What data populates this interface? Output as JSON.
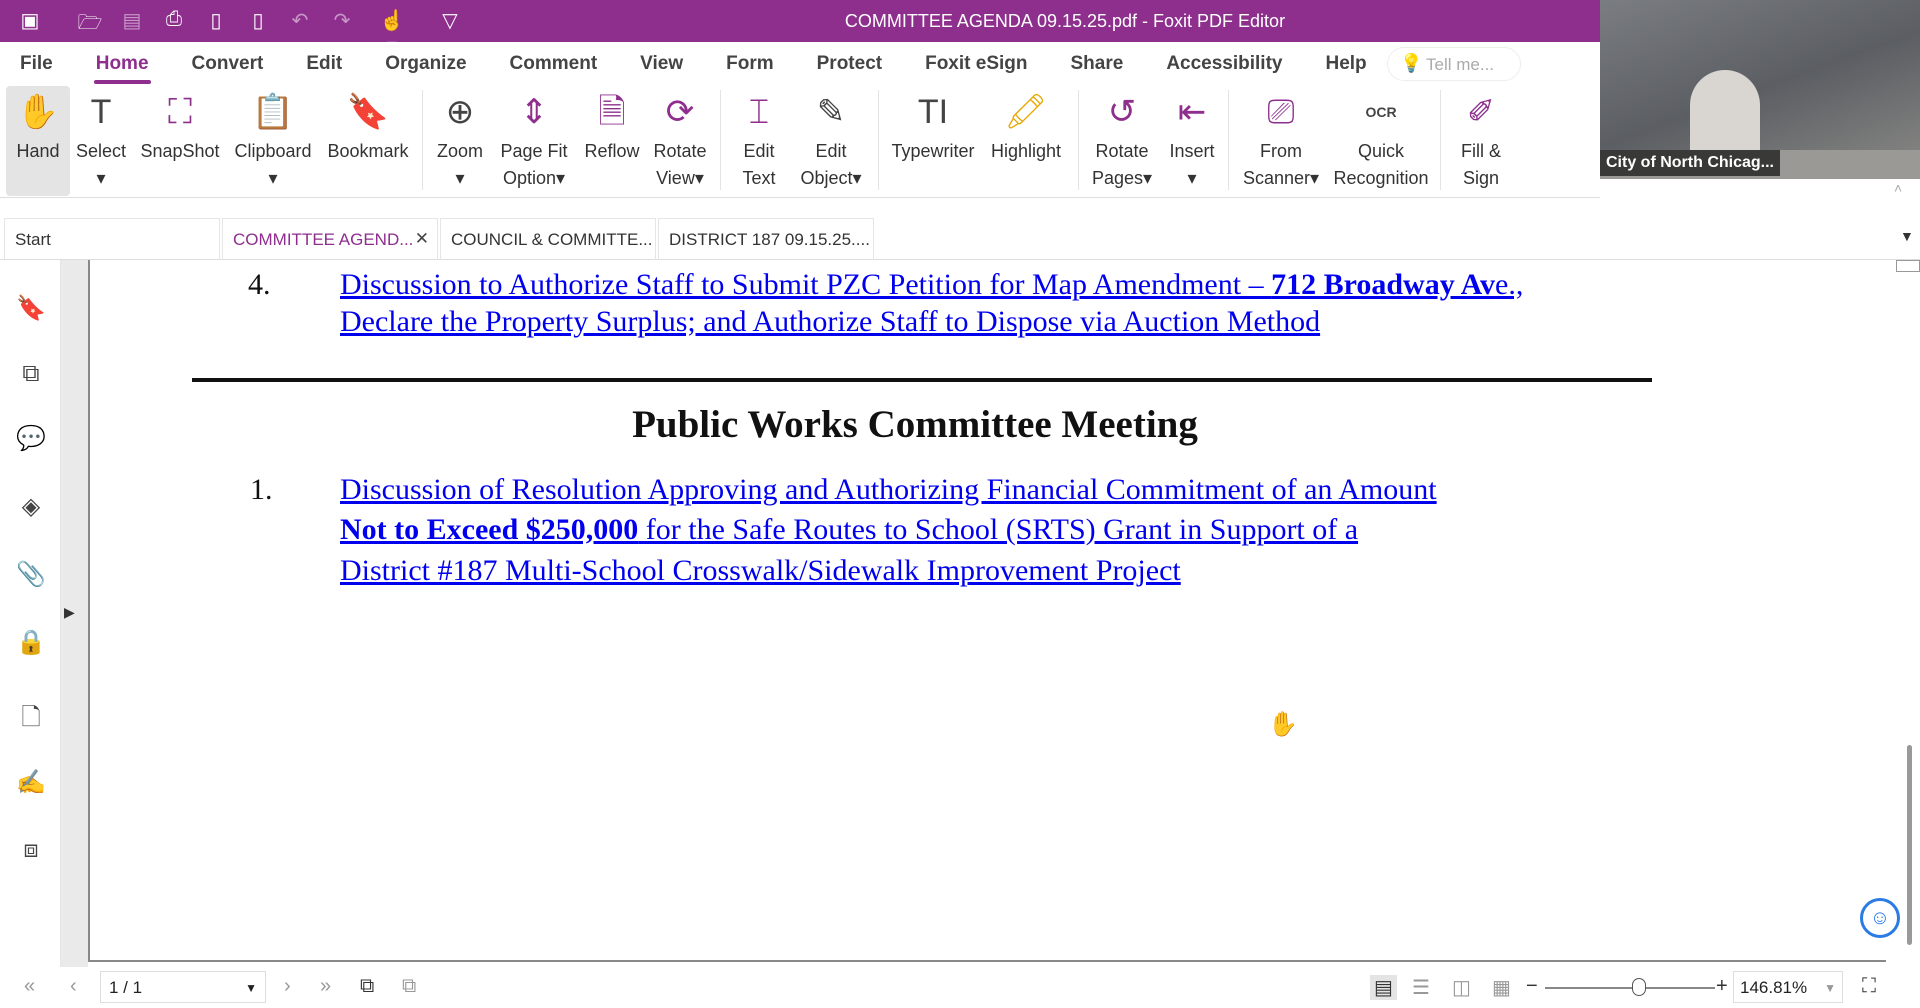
{
  "window": {
    "title": "COMMITTEE AGENDA 09.15.25.pdf - Foxit PDF Editor"
  },
  "menu": [
    "File",
    "Home",
    "Convert",
    "Edit",
    "Organize",
    "Comment",
    "View",
    "Form",
    "Protect",
    "Foxit eSign",
    "Share",
    "Accessibility",
    "Help"
  ],
  "search": {
    "placeholder": "Tell me..."
  },
  "ribbon": {
    "hand": "Hand",
    "select": "Select",
    "snapshot": "SnapShot",
    "clipboard": "Clipboard",
    "bookmark": "Bookmark",
    "zoom": "Zoom",
    "pagefit1": "Page Fit",
    "pagefit2": "Option",
    "reflow": "Reflow",
    "rotate1": "Rotate",
    "rotate2": "View",
    "edittext1": "Edit",
    "edittext2": "Text",
    "editobj1": "Edit",
    "editobj2": "Object",
    "typewriter": "Typewriter",
    "highlight": "Highlight",
    "rotpages1": "Rotate",
    "rotpages2": "Pages",
    "insert": "Insert",
    "scanner1": "From",
    "scanner2": "Scanner",
    "ocr1": "Quick",
    "ocr2": "Recognition",
    "fill1": "Fill &",
    "fill2": "Sign",
    "ocr_icon": "OCR"
  },
  "video": {
    "caption": "City of North Chicag..."
  },
  "tabs": [
    "Start",
    "COMMITTEE AGEND...",
    "COUNCIL & COMMITTE...",
    "DISTRICT 187 09.15.25...."
  ],
  "document": {
    "item4": {
      "num": "4.",
      "line1a": "Discussion to Authorize Staff to Submit PZC Petition for Map Amendment – ",
      "line1b": "712 Broadway Av",
      "line1c": "e.,",
      "line2": "Declare the Property Surplus; and Authorize Staff to Dispose via Auction Method"
    },
    "heading": "Public Works Committee Meeting",
    "item1": {
      "num": "1.",
      "line1": "Discussion of Resolution Approving and Authorizing Financial Commitment of an Amount",
      "line2a": "Not to Exceed $250,000",
      "line2b": " for the Safe Routes to School (SRTS) Grant in Support of a",
      "line3": "District #187 Multi-School Crosswalk/Sidewalk Improvement Project"
    }
  },
  "status": {
    "page": "1 / 1",
    "zoom": "146.81%",
    "zoom_fraction": 0.55
  },
  "colors": {
    "accent": "#8e2e8d",
    "link": "#0000ee"
  }
}
